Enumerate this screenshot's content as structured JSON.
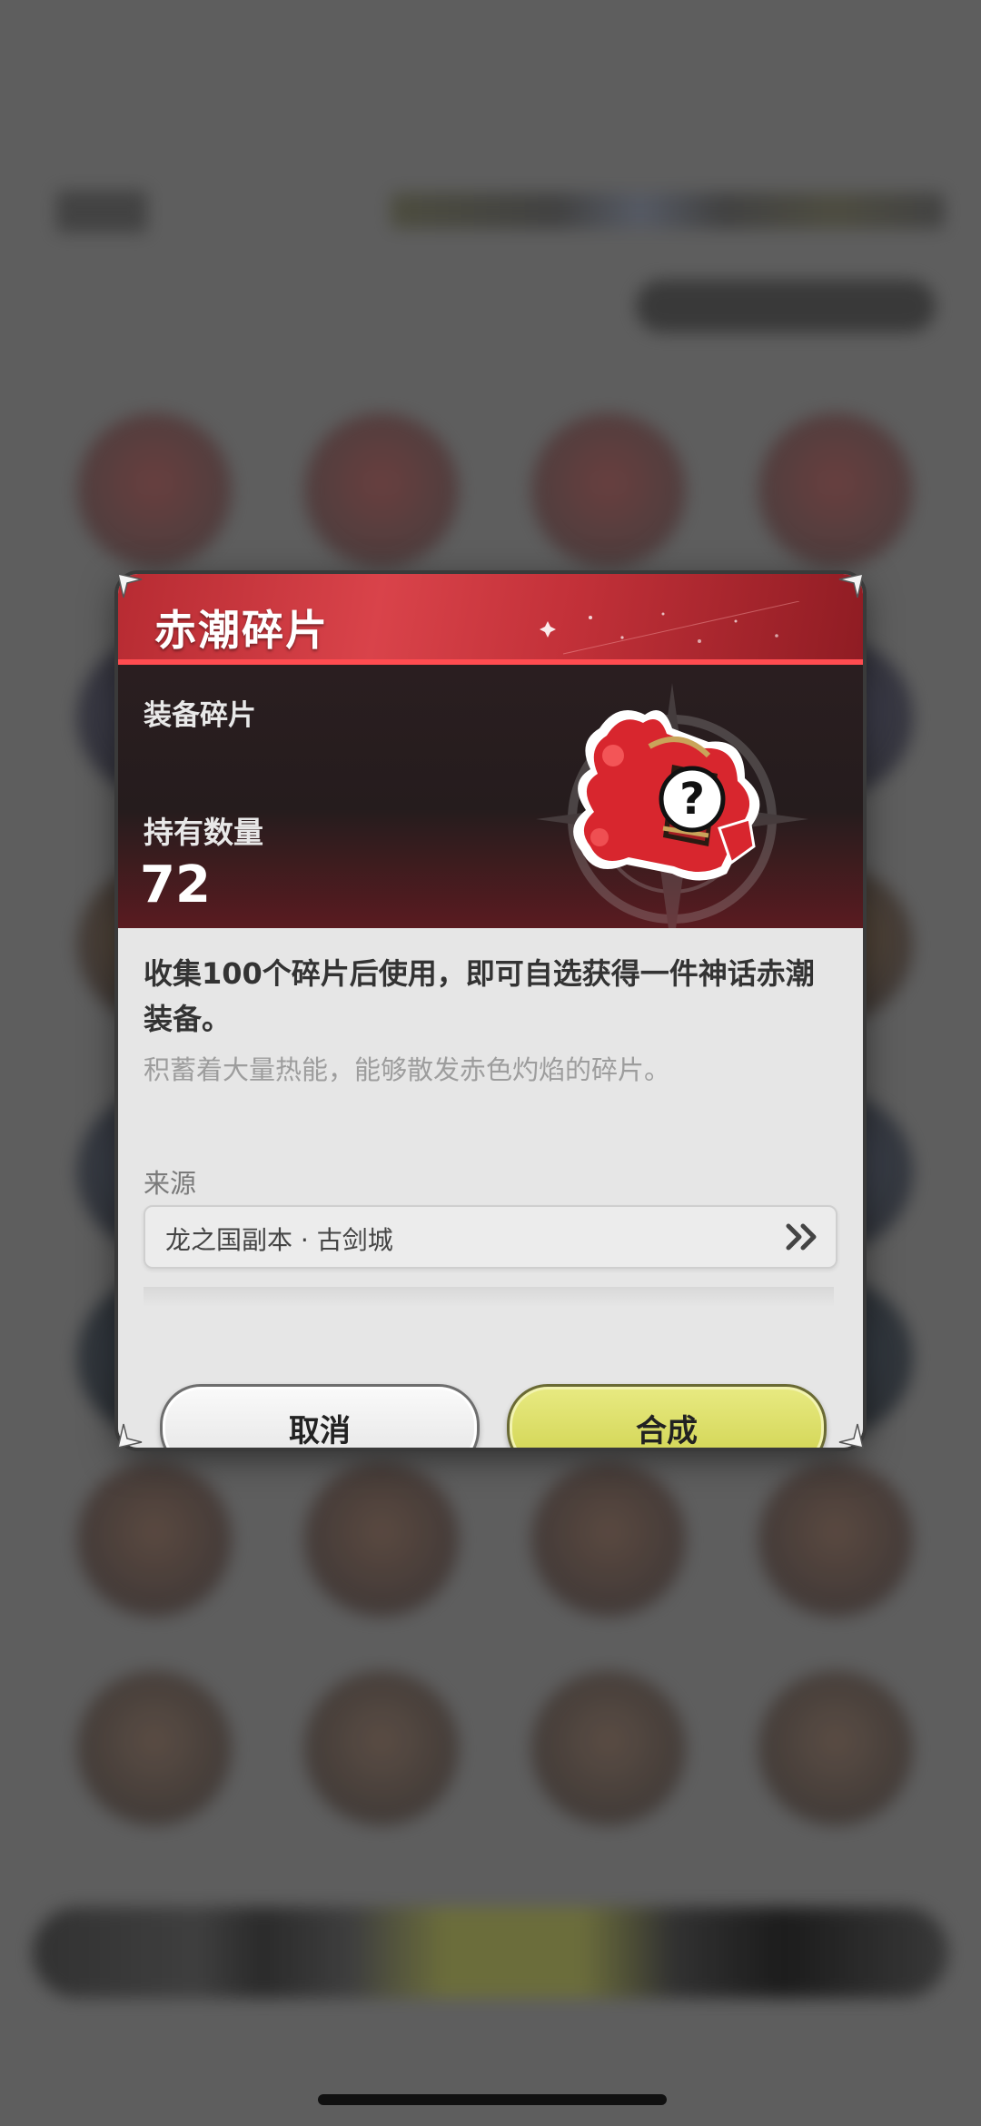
{
  "modal": {
    "title": "赤潮碎片",
    "category": "装备碎片",
    "quantity_label": "持有数量",
    "quantity_value": "72",
    "description": "收集100个碎片后使用，即可自选获得一件神话赤潮装备。",
    "flavor_text": "积蓄着大量热能，能够散发赤色灼焰的碎片。",
    "source_label": "来源",
    "source_value": "龙之国副本 · 古剑城",
    "source_icon": "double-chevron-right-icon",
    "item_icon": "mystery-equipment-fragment-icon",
    "cancel_label": "取消",
    "confirm_label": "合成"
  },
  "colors": {
    "title_red": "#d9434a",
    "accent_red": "#ff4c50",
    "confirm_yellow": "#d6d85a",
    "panel_dark": "#251c1d",
    "body_gray": "#e6e6e6"
  }
}
